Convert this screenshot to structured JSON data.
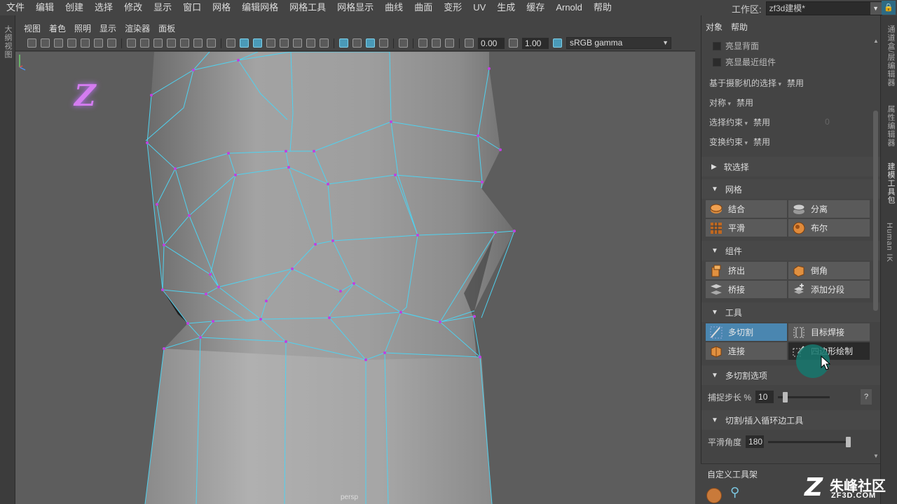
{
  "menubar": {
    "items": [
      "文件",
      "编辑",
      "创建",
      "选择",
      "修改",
      "显示",
      "窗口",
      "网格",
      "编辑网格",
      "网格工具",
      "网格显示",
      "曲线",
      "曲面",
      "变形",
      "UV",
      "生成",
      "缓存",
      "Arnold",
      "帮助"
    ],
    "workspace_label": "工作区:",
    "workspace_value": "zf3d建模*"
  },
  "left_strip": {
    "label": "大纲视图"
  },
  "viewport_panel": {
    "menu": [
      "视图",
      "着色",
      "照明",
      "显示",
      "渲染器",
      "面板"
    ],
    "toolbar": {
      "value_a": "0.00",
      "value_b": "1.00",
      "colorspace": "sRGB gamma"
    },
    "camera_label": "persp",
    "logo_glyph": "Z"
  },
  "tool_panel": {
    "tabs": [
      "对象",
      "帮助"
    ],
    "checkboxes": [
      "亮显背面",
      "亮显最近组件"
    ],
    "settings": [
      {
        "label": "基于摄影机的选择",
        "value": "禁用"
      },
      {
        "label": "对称",
        "value": "禁用"
      },
      {
        "label": "选择约束",
        "value": "禁用",
        "extra": "0"
      },
      {
        "label": "变换约束",
        "value": "禁用"
      }
    ],
    "soft_select": "软选择",
    "sections": {
      "mesh": {
        "title": "网格",
        "buttons": [
          "结合",
          "分离",
          "平滑",
          "布尔"
        ]
      },
      "components": {
        "title": "组件",
        "buttons": [
          "挤出",
          "倒角",
          "桥接",
          "添加分段"
        ]
      },
      "tools": {
        "title": "工具",
        "buttons": [
          "多切割",
          "目标焊接",
          "连接",
          "四边形绘制"
        ]
      }
    },
    "multicut_options": {
      "title": "多切割选项",
      "snap_label": "捕捉步长 %",
      "snap_value": "10",
      "snap_fraction": 0.1,
      "help": "?"
    },
    "loop_tool": {
      "title": "切割/插入循环边工具",
      "smooth_label": "平滑角度",
      "smooth_value": "180",
      "smooth_fraction": 1.0
    },
    "shelf_title": "自定义工具架"
  },
  "right_tabs": [
    "通道盒/层编辑器",
    "属性编辑器",
    "建模工具包",
    "Human IK"
  ],
  "watermark": {
    "name": "朱峰社区",
    "url": "ZF3D.COM",
    "glyph": "Z"
  },
  "colors": {
    "wire": "#4fd2f0",
    "vertex": "#c040e0",
    "active_button": "#4a86b0",
    "viewport_bg": "#5d5d5d"
  }
}
